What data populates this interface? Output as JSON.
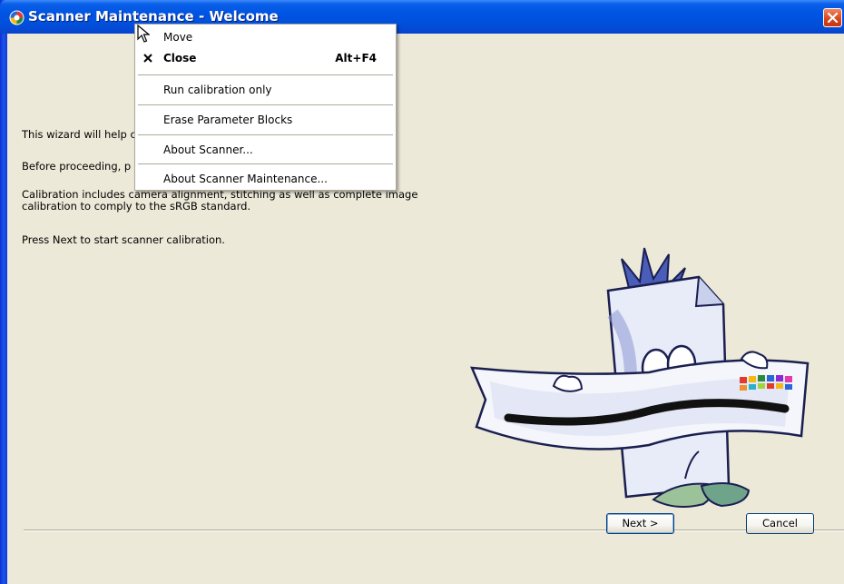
{
  "window": {
    "title": "Scanner Maintenance - Welcome",
    "icon": "scanner-app-icon",
    "close_icon": "close-icon"
  },
  "content": {
    "paragraphs": [
      "This wizard will help c",
      "Before proceeding, p                                                                              clean.",
      "Calibration includes camera alignment, stitching as well as complete image\ncalibration to comply to the sRGB standard.",
      "Press Next to start scanner calibration."
    ],
    "illustration": "scanner-mascot-illustration"
  },
  "buttons": {
    "next": "Next >",
    "cancel": "Cancel"
  },
  "system_menu": {
    "items": [
      {
        "label": "Move",
        "accelerator": "",
        "icon": "",
        "bold": false
      },
      {
        "label": "Close",
        "accelerator": "Alt+F4",
        "icon": "close-x-icon",
        "bold": true
      },
      {
        "label": "Run calibration only",
        "accelerator": "",
        "icon": "",
        "bold": false
      },
      {
        "label": "Erase Parameter Blocks",
        "accelerator": "",
        "icon": "",
        "bold": false
      },
      {
        "label": "About Scanner...",
        "accelerator": "",
        "icon": "",
        "bold": false
      },
      {
        "label": "About Scanner Maintenance...",
        "accelerator": "",
        "icon": "",
        "bold": false
      }
    ]
  },
  "colors": {
    "titlebar": "#0054e3",
    "window_bg": "#ece9d8",
    "close_button": "#d9431c"
  }
}
